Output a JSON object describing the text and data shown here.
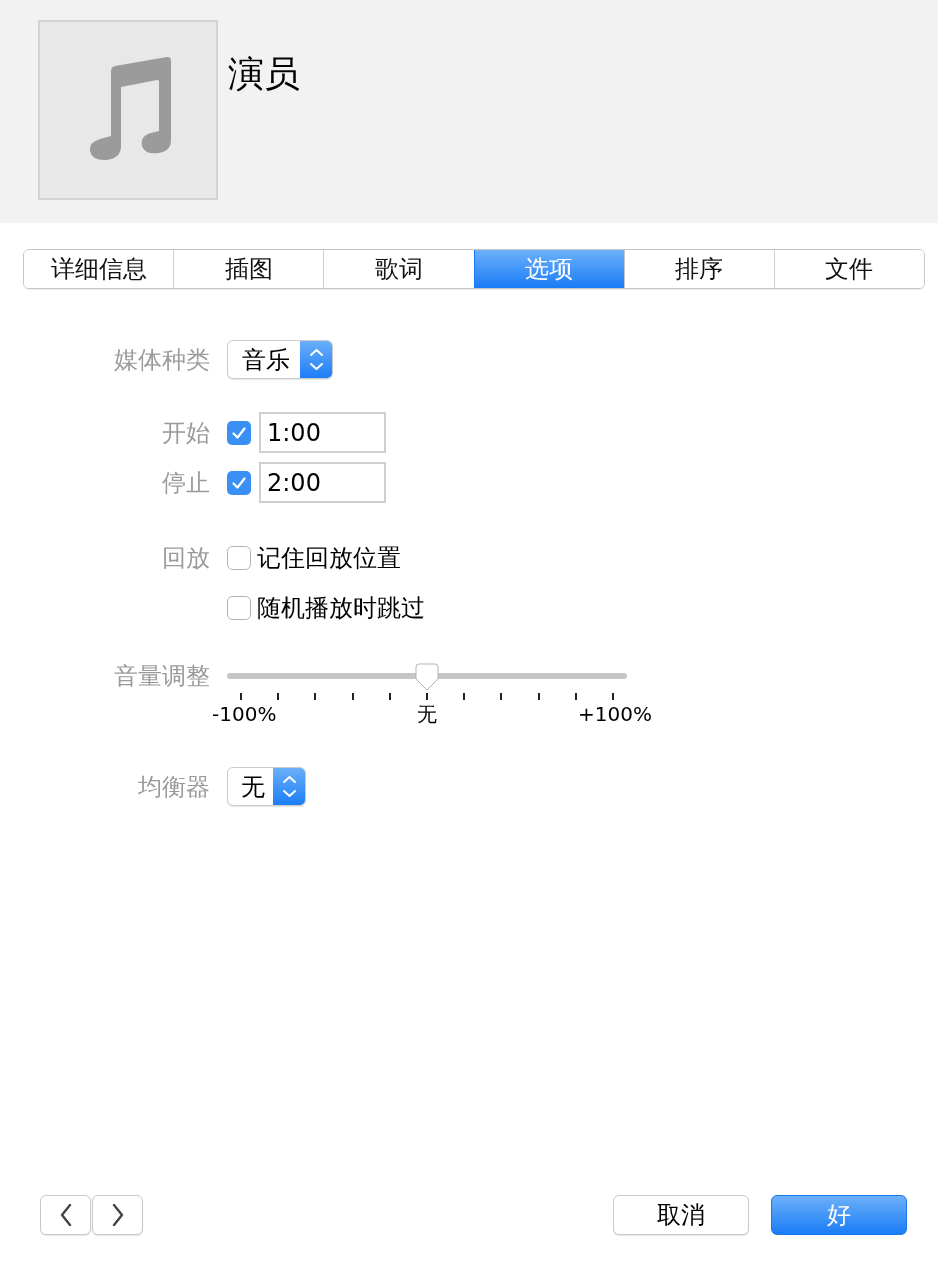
{
  "header": {
    "title": "演员"
  },
  "tabs": [
    {
      "label": "详细信息",
      "selected": false
    },
    {
      "label": "插图",
      "selected": false
    },
    {
      "label": "歌词",
      "selected": false
    },
    {
      "label": "选项",
      "selected": true
    },
    {
      "label": "排序",
      "selected": false
    },
    {
      "label": "文件",
      "selected": false
    }
  ],
  "form": {
    "media_kind": {
      "label": "媒体种类",
      "value": "音乐"
    },
    "start": {
      "label": "开始",
      "checked": true,
      "value": "1:00"
    },
    "stop": {
      "label": "停止",
      "checked": true,
      "value": "2:00"
    },
    "playback": {
      "label": "回放",
      "options": [
        {
          "label": "记住回放位置",
          "checked": false
        },
        {
          "label": "随机播放时跳过",
          "checked": false
        }
      ]
    },
    "volume": {
      "label": "音量调整",
      "level": 0.5,
      "min_label": "-100%",
      "mid_label": "无",
      "max_label": "+100%"
    },
    "equalizer": {
      "label": "均衡器",
      "value": "无"
    }
  },
  "buttons": [
    {
      "kind": "cancel",
      "label": "取消"
    },
    {
      "kind": "ok",
      "label": "好"
    }
  ]
}
